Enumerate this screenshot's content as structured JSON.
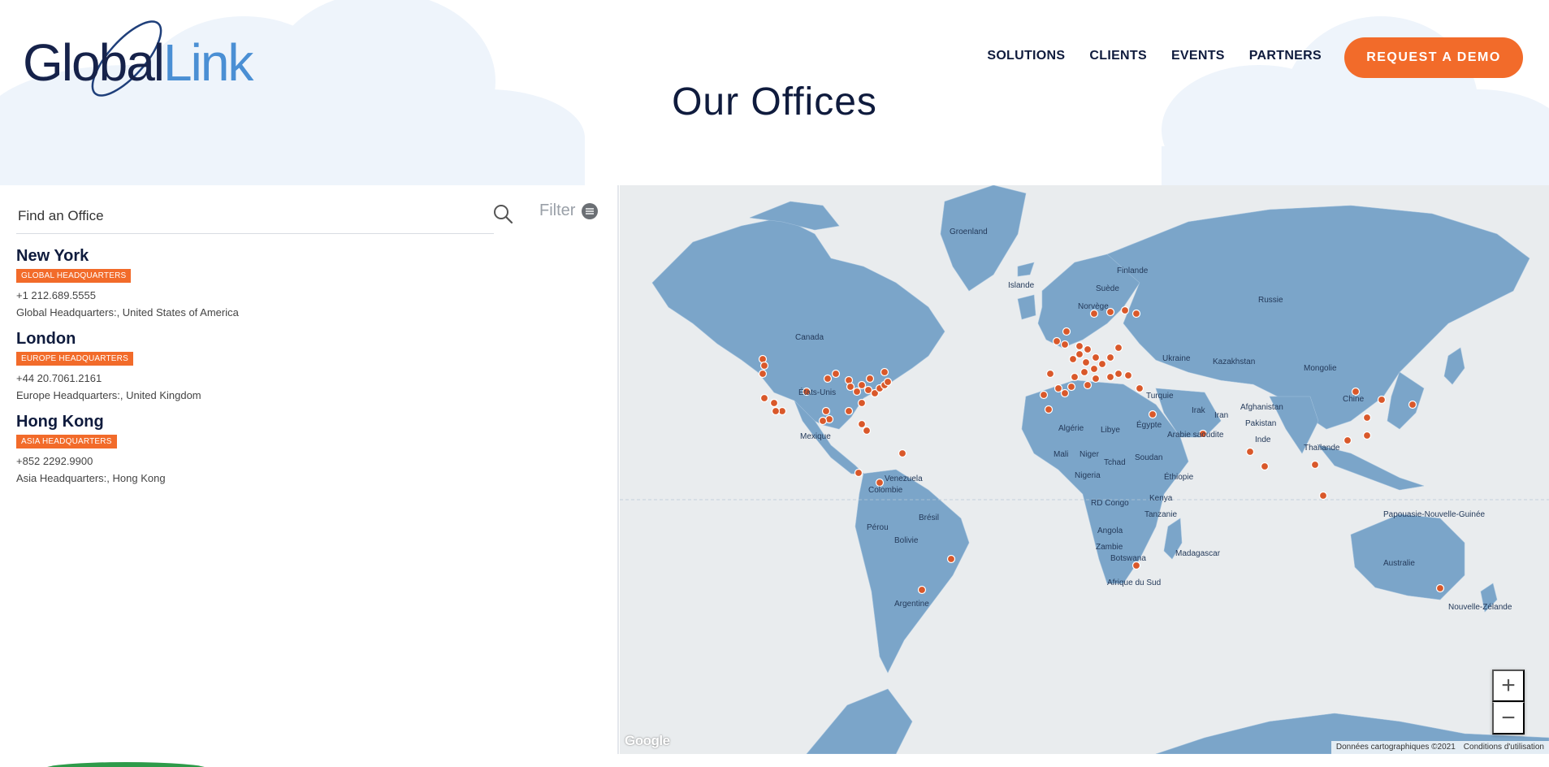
{
  "brand": {
    "logo_part1": "Global",
    "logo_part2": "Link"
  },
  "nav": {
    "items": [
      "SOLUTIONS",
      "CLIENTS",
      "EVENTS",
      "PARTNERS"
    ],
    "cta": "REQUEST A DEMO"
  },
  "page": {
    "title": "Our Offices"
  },
  "search": {
    "placeholder": "Find an Office",
    "filter_label": "Filter"
  },
  "offices": [
    {
      "name": "New York",
      "badge": "GLOBAL HEADQUARTERS",
      "phone": "+1 212.689.5555",
      "address": "Global Headquarters:, United States of America"
    },
    {
      "name": "London",
      "badge": "EUROPE HEADQUARTERS",
      "phone": "+44 20.7061.2161",
      "address": "Europe Headquarters:, United Kingdom"
    },
    {
      "name": "Hong Kong",
      "badge": "ASIA HEADQUARTERS",
      "phone": "+852 2292.9900",
      "address": "Asia Headquarters:, Hong Kong"
    }
  ],
  "map": {
    "labels": {
      "groenland": "Groenland",
      "canada": "Canada",
      "etats_unis": "États-Unis",
      "mexique": "Mexique",
      "venezuela": "Venezuela",
      "colombie": "Colombie",
      "perou": "Pérou",
      "bresil": "Brésil",
      "bolivie": "Bolivie",
      "argentine": "Argentine",
      "islande": "Islande",
      "finlande": "Finlande",
      "suede": "Suède",
      "norvege": "Norvège",
      "russie": "Russie",
      "ukraine": "Ukraine",
      "kazakhstan": "Kazakhstan",
      "mongolie": "Mongolie",
      "chine": "Chine",
      "turquie": "Turquie",
      "irak": "Irak",
      "iran": "Iran",
      "afghanistan": "Afghanistan",
      "pakistan": "Pakistan",
      "inde": "Inde",
      "thailande": "Thaïlande",
      "algerie": "Algérie",
      "libye": "Libye",
      "egypte": "Égypte",
      "arabie_saoudite": "Arabie saoudite",
      "mali": "Mali",
      "niger": "Niger",
      "tchad": "Tchad",
      "soudan": "Soudan",
      "nigeria": "Nigeria",
      "ethiopie": "Éthiopie",
      "rd_congo": "RD Congo",
      "kenya": "Kenya",
      "tanzanie": "Tanzanie",
      "angola": "Angola",
      "zambie": "Zambie",
      "botswana": "Botswana",
      "afrique_du_sud": "Afrique du Sud",
      "madagascar": "Madagascar",
      "australie": "Australie",
      "papouasie": "Papouasie-Nouvelle-Guinée",
      "nouvelle_zelande": "Nouvelle-Zélande"
    },
    "zoom_in": "+",
    "zoom_out": "−",
    "google": "Google",
    "attribution": "Données cartographiques ©2021",
    "terms": "Conditions d'utilisation",
    "marker_color": "#d9582a",
    "land_color": "#7ba5c9",
    "water_color": "#e9ecee"
  },
  "colors": {
    "accent": "#f26b2a",
    "navy": "#0f1b3d",
    "brand_blue": "#4a8fd4"
  }
}
